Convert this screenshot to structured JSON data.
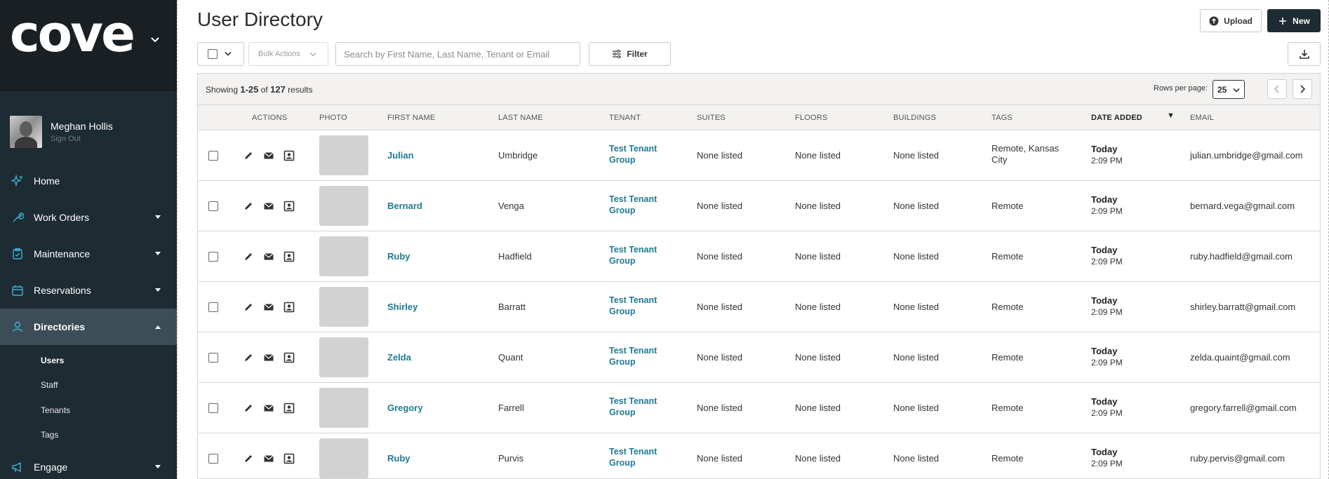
{
  "brand": {
    "logo_text": "cove"
  },
  "colors": {
    "sidebar_bg": "#1d2b33",
    "accent": "#1f7a94",
    "link": "#1f7a94",
    "active_nav": "#3d4d57"
  },
  "profile": {
    "name": "Meghan Hollis",
    "signout": "Sign Out"
  },
  "nav": {
    "items": [
      {
        "label": "Home",
        "icon": "sparkle-icon"
      },
      {
        "label": "Work Orders",
        "icon": "wrench-icon"
      },
      {
        "label": "Maintenance",
        "icon": "clipboard-icon"
      },
      {
        "label": "Reservations",
        "icon": "calendar-icon"
      },
      {
        "label": "Directories",
        "icon": "person-icon"
      },
      {
        "label": "Engage",
        "icon": "megaphone-icon"
      }
    ],
    "sub_items": [
      "Users",
      "Staff",
      "Tenants",
      "Tags"
    ]
  },
  "header": {
    "title": "User Directory",
    "upload_label": "Upload",
    "new_label": "New"
  },
  "toolbar": {
    "bulk_actions": "Bulk Actions",
    "search_placeholder": "Search by First Name, Last Name, Tenant or Email",
    "filter_label": "Filter"
  },
  "results": {
    "showing_prefix": "Showing",
    "range": "1-25",
    "of": "of",
    "total": "127",
    "suffix": "results",
    "rows_per_page_label": "Rows per page:",
    "rows_per_page": "25"
  },
  "table": {
    "headers": {
      "actions": "ACTIONS",
      "photo": "PHOTO",
      "first_name": "FIRST NAME",
      "last_name": "LAST NAME",
      "tenant": "TENANT",
      "suites": "SUITES",
      "floors": "FLOORS",
      "buildings": "BUILDINGS",
      "tags": "TAGS",
      "date_added": "DATE ADDED",
      "email": "EMAIL"
    },
    "sort_indicator": "▼",
    "rows": [
      {
        "first": "Julian",
        "last": "Umbridge",
        "tenant": "Test Tenant Group",
        "suites": "None listed",
        "floors": "None listed",
        "buildings": "None listed",
        "tags": "Remote, Kansas City",
        "date": "Today",
        "time": "2:09 PM",
        "email": "julian.umbridge@gmail.com"
      },
      {
        "first": "Bernard",
        "last": "Venga",
        "tenant": "Test Tenant Group",
        "suites": "None listed",
        "floors": "None listed",
        "buildings": "None listed",
        "tags": "Remote",
        "date": "Today",
        "time": "2:09 PM",
        "email": "bernard.vega@gmail.com"
      },
      {
        "first": "Ruby",
        "last": "Hadfield",
        "tenant": "Test Tenant Group",
        "suites": "None listed",
        "floors": "None listed",
        "buildings": "None listed",
        "tags": "Remote",
        "date": "Today",
        "time": "2:09 PM",
        "email": "ruby.hadfield@gmail.com"
      },
      {
        "first": "Shirley",
        "last": "Barratt",
        "tenant": "Test Tenant Group",
        "suites": "None listed",
        "floors": "None listed",
        "buildings": "None listed",
        "tags": "Remote",
        "date": "Today",
        "time": "2:09 PM",
        "email": "shirley.barratt@gmail.com"
      },
      {
        "first": "Zelda",
        "last": "Quant",
        "tenant": "Test Tenant Group",
        "suites": "None listed",
        "floors": "None listed",
        "buildings": "None listed",
        "tags": "Remote",
        "date": "Today",
        "time": "2:09 PM",
        "email": "zelda.quaint@gmail.com"
      },
      {
        "first": "Gregory",
        "last": "Farrell",
        "tenant": "Test Tenant Group",
        "suites": "None listed",
        "floors": "None listed",
        "buildings": "None listed",
        "tags": "Remote",
        "date": "Today",
        "time": "2:09 PM",
        "email": "gregory.farrell@gmail.com"
      },
      {
        "first": "Ruby",
        "last": "Purvis",
        "tenant": "Test Tenant Group",
        "suites": "None listed",
        "floors": "None listed",
        "buildings": "None listed",
        "tags": "Remote",
        "date": "Today",
        "time": "2:09 PM",
        "email": "ruby.pervis@gmail.com"
      }
    ]
  }
}
